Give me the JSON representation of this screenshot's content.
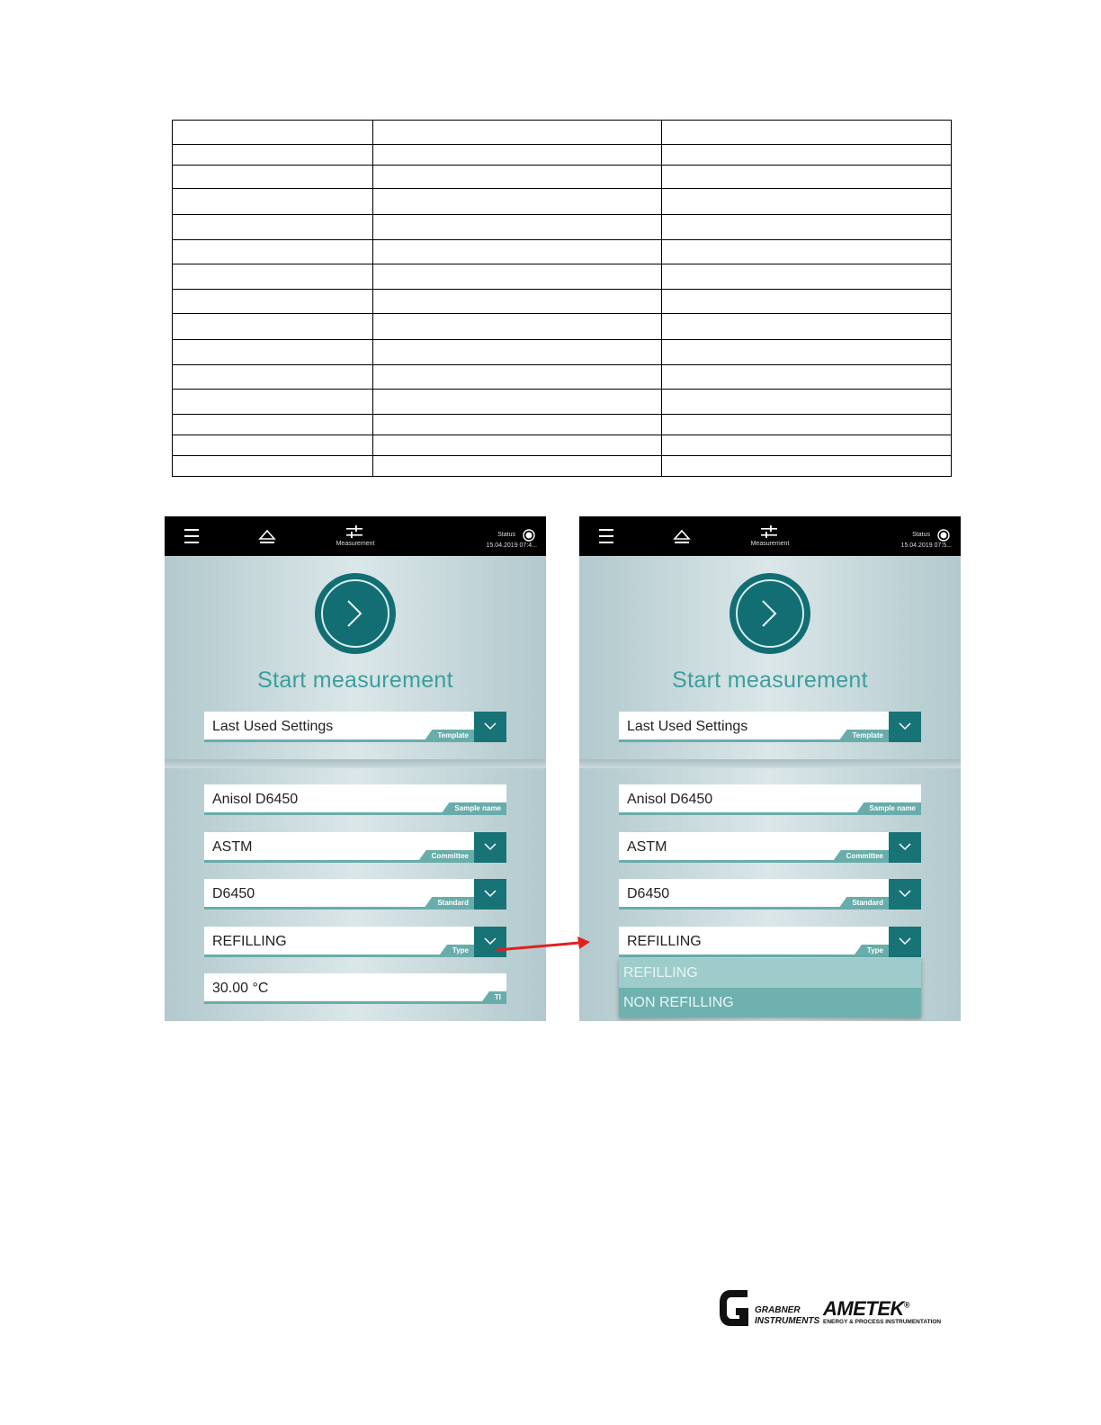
{
  "table": {
    "rows": 15,
    "cols": 3
  },
  "nav": {
    "nav_label": "Measurement",
    "status_label": "Status"
  },
  "panels": [
    {
      "status_time": "15.04.2019 07:4...",
      "title": "Start measurement",
      "template": {
        "value": "Last Used Settings",
        "tag": "Template"
      },
      "sample": {
        "value": "Anisol D6450",
        "tag": "Sample name"
      },
      "committee": {
        "value": "ASTM",
        "tag": "Committee"
      },
      "standard": {
        "value": "D6450",
        "tag": "Standard"
      },
      "type": {
        "value": "REFILLING",
        "tag": "Type"
      },
      "temperature": {
        "value": "30.00  °C",
        "tag": "TI"
      }
    },
    {
      "status_time": "15.04.2019 07:5...",
      "title": "Start measurement",
      "template": {
        "value": "Last Used Settings",
        "tag": "Template"
      },
      "sample": {
        "value": "Anisol D6450",
        "tag": "Sample name"
      },
      "committee": {
        "value": "ASTM",
        "tag": "Committee"
      },
      "standard": {
        "value": "D6450",
        "tag": "Standard"
      },
      "type": {
        "value": "REFILLING",
        "tag": "Type"
      },
      "type_options": [
        "REFILLING",
        "NON REFILLING"
      ]
    }
  ],
  "colors": {
    "teal_dark": "#126e73",
    "teal_light": "#68adab",
    "title": "#3d9e9d",
    "arrow": "#e02020"
  },
  "footer": {
    "grabner_line1": "GRABNER",
    "grabner_line2": "INSTRUMENTS",
    "ametek": "AMETEK",
    "ametek_reg": "®",
    "ametek_sub": "ENERGY & PROCESS INSTRUMENTATION"
  }
}
